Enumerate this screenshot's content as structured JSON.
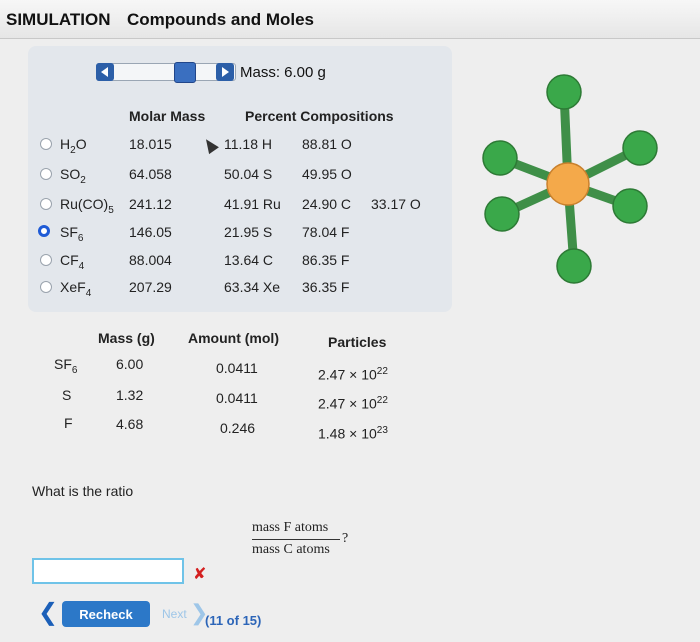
{
  "header": {
    "sim_label": "SIMULATION",
    "title": "Compounds and Moles"
  },
  "mass_control": {
    "label": "Mass: 6.00 g"
  },
  "compounds_table": {
    "headers": {
      "molar_mass": "Molar Mass",
      "percent": "Percent Compositions"
    },
    "rows": [
      {
        "formula_main": "H",
        "formula_sub": "2",
        "formula_tail": "O",
        "molar_mass": "18.015",
        "p1": "11.18 H",
        "p2": "88.81 O",
        "p3": "",
        "selected": false
      },
      {
        "formula_main": "SO",
        "formula_sub": "2",
        "formula_tail": "",
        "molar_mass": "64.058",
        "p1": "50.04 S",
        "p2": "49.95 O",
        "p3": "",
        "selected": false
      },
      {
        "formula_main": "Ru(CO)",
        "formula_sub": "5",
        "formula_tail": "",
        "molar_mass": "241.12",
        "p1": "41.91 Ru",
        "p2": "24.90 C",
        "p3": "33.17 O",
        "selected": false
      },
      {
        "formula_main": "SF",
        "formula_sub": "6",
        "formula_tail": "",
        "molar_mass": "146.05",
        "p1": "21.95 S",
        "p2": "78.04 F",
        "p3": "",
        "selected": true
      },
      {
        "formula_main": "CF",
        "formula_sub": "4",
        "formula_tail": "",
        "molar_mass": "88.004",
        "p1": "13.64 C",
        "p2": "86.35 F",
        "p3": "",
        "selected": false
      },
      {
        "formula_main": "XeF",
        "formula_sub": "4",
        "formula_tail": "",
        "molar_mass": "207.29",
        "p1": "63.34 Xe",
        "p2": "36.35 F",
        "p3": "",
        "selected": false
      }
    ]
  },
  "amount_table": {
    "headers": {
      "mass": "Mass (g)",
      "amount": "Amount (mol)",
      "particles": "Particles"
    },
    "rows": [
      {
        "label_main": "SF",
        "label_sub": "6",
        "mass": "6.00",
        "amount": "0.0411",
        "particles_base": "2.47 × 10",
        "particles_exp": "22"
      },
      {
        "label_main": "S",
        "label_sub": "",
        "mass": "1.32",
        "amount": "0.0411",
        "particles_base": "2.47 × 10",
        "particles_exp": "22"
      },
      {
        "label_main": "F",
        "label_sub": "",
        "mass": "4.68",
        "amount": "0.246",
        "particles_base": "1.48 × 10",
        "particles_exp": "23"
      }
    ]
  },
  "question": {
    "prompt": "What is the ratio",
    "numerator": "mass F atoms",
    "denominator": "mass C atoms",
    "suffix": "?",
    "answer_value": ""
  },
  "nav": {
    "recheck_label": "Recheck",
    "next_label": "Next",
    "progress": "(11 of 15)"
  },
  "colors": {
    "accent": "#2c78c8",
    "central_atom": "#f4a94a",
    "outer_atom": "#3aa84a",
    "error": "#d42020"
  }
}
